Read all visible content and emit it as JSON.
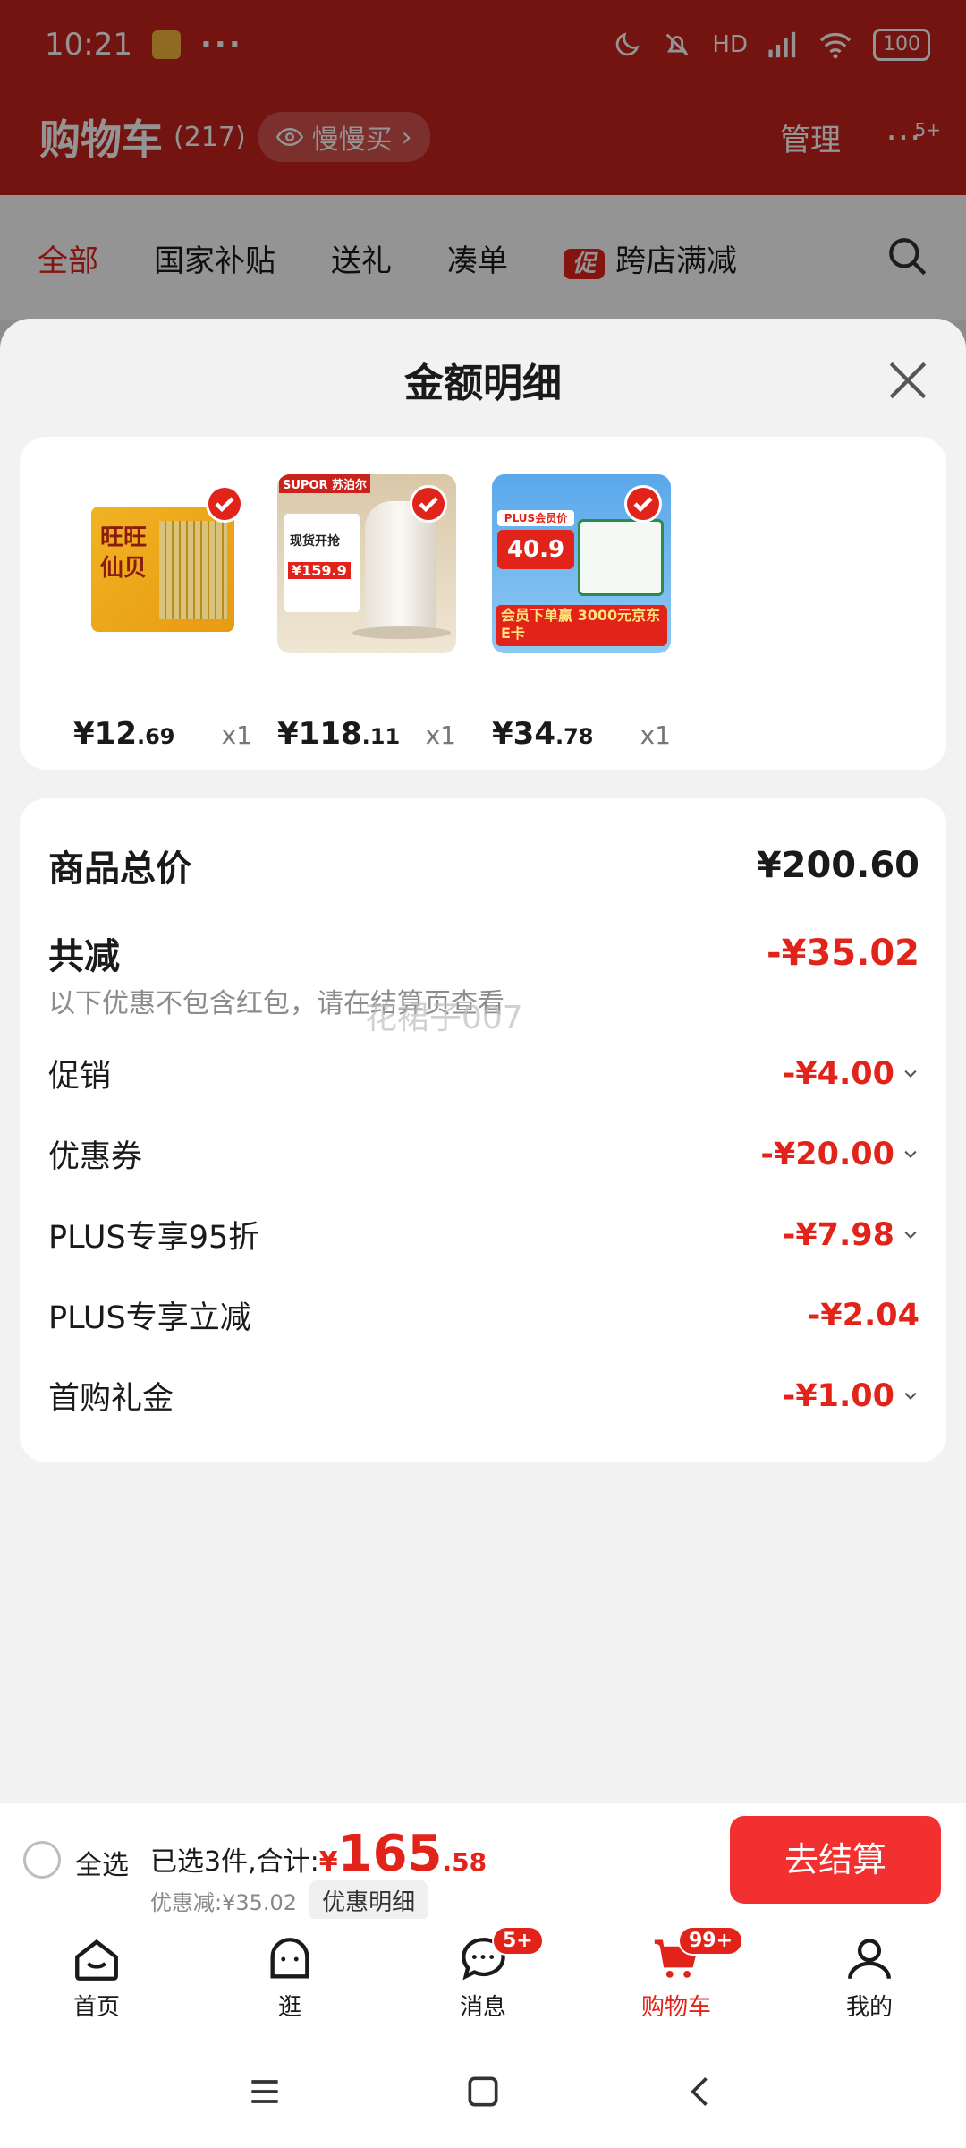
{
  "status_bar": {
    "time": "10:21",
    "dots": "···",
    "network": "HD",
    "wifi_label": "6",
    "battery": "100"
  },
  "header": {
    "title": "购物车",
    "count": "(217)",
    "slow_buy": "慢慢买",
    "manage": "管理",
    "more_badge": "5+"
  },
  "tabs": [
    {
      "label": "全部",
      "active": true
    },
    {
      "label": "国家补贴"
    },
    {
      "label": "送礼"
    },
    {
      "label": "凑单"
    },
    {
      "label": "跨店满减",
      "tag": "促"
    }
  ],
  "sheet": {
    "title": "金额明细"
  },
  "products": [
    {
      "price_int": "¥12",
      "price_dec": ".69",
      "qty": "x1",
      "image_icon": "rice-cracker-product"
    },
    {
      "price_int": "¥118",
      "price_dec": ".11",
      "qty": "x1",
      "image_icon": "thermos-kettle-product"
    },
    {
      "price_int": "¥34",
      "price_dec": ".78",
      "qty": "x1",
      "image_icon": "milk-product"
    }
  ],
  "product_images": {
    "p1_text": "旺旺 仙贝",
    "p2_brand": "SUPOR 苏泊尔",
    "p2_price": "¥159.9",
    "p2_promo": "现货开抢",
    "p3_badge": "PLUS会员价",
    "p3_price": "40.9",
    "p3_promo": "会员下单赢 3000元京东E卡"
  },
  "summary": {
    "total_label": "商品总价",
    "total_value": "¥200.60",
    "reduce_label": "共减",
    "reduce_value": "-¥35.02",
    "note": "以下优惠不包含红包，请在结算页查看",
    "watermark": "花裙子007",
    "items": [
      {
        "label": "促销",
        "value": "-¥4.00",
        "chevron": true
      },
      {
        "label": "优惠券",
        "value": "-¥20.00",
        "chevron": true
      },
      {
        "label": "PLUS专享95折",
        "value": "-¥7.98",
        "chevron": true
      },
      {
        "label": "PLUS专享立减",
        "value": "-¥2.04",
        "chevron": false
      },
      {
        "label": "首购礼金",
        "value": "-¥1.00",
        "chevron": true
      }
    ]
  },
  "checkout": {
    "select_all": "全选",
    "selected_text": "已选3件,合计:",
    "yen": "¥",
    "total_int": "165",
    "total_dec": ".58",
    "discount_text": "优惠减:¥35.02",
    "detail_button": "优惠明细",
    "checkout_button": "去结算"
  },
  "bottom_nav": [
    {
      "label": "首页",
      "icon": "home-icon"
    },
    {
      "label": "逛",
      "icon": "explore-icon"
    },
    {
      "label": "消息",
      "icon": "message-icon",
      "badge": "5+"
    },
    {
      "label": "购物车",
      "icon": "cart-icon",
      "badge": "99+",
      "active": true
    },
    {
      "label": "我的",
      "icon": "profile-icon"
    }
  ],
  "colors": {
    "accent": "#e2231a",
    "header_bg": "#c8241d",
    "checkout_button": "#f23030"
  }
}
